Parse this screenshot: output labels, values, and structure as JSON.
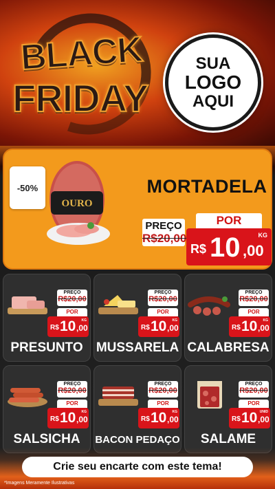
{
  "header": {
    "title_line1": "BLACK",
    "title_line2": "FRIDAY",
    "logo_line1": "SUA",
    "logo_line2": "LOGO",
    "logo_line3": "AQUI"
  },
  "hero": {
    "discount": "-50%",
    "name": "MORTADELA",
    "brand_label": "OURO",
    "price_label": "PREÇO",
    "old_price": "R$20,00",
    "por_label": "POR",
    "currency": "R$",
    "price_int": "10",
    "price_dec": ",00",
    "unit": "KG"
  },
  "products": [
    {
      "name": "PRESUNTO",
      "price_label": "PREÇO",
      "old_price": "R$20,00",
      "por_label": "POR",
      "currency": "R$",
      "price_int": "10",
      "price_dec": ",00",
      "unit": "KG"
    },
    {
      "name": "MUSSARELA",
      "price_label": "PREÇO",
      "old_price": "R$20,00",
      "por_label": "POR",
      "currency": "R$",
      "price_int": "10",
      "price_dec": ",00",
      "unit": "KG"
    },
    {
      "name": "CALABRESA",
      "price_label": "PREÇO",
      "old_price": "R$20,00",
      "por_label": "POR",
      "currency": "R$",
      "price_int": "10",
      "price_dec": ",00",
      "unit": "KG"
    },
    {
      "name": "SALSICHA",
      "price_label": "PREÇO",
      "old_price": "R$20,00",
      "por_label": "POR",
      "currency": "R$",
      "price_int": "10",
      "price_dec": ",00",
      "unit": "KG"
    },
    {
      "name": "BACON PEDAÇO",
      "price_label": "PREÇO",
      "old_price": "R$20,00",
      "por_label": "POR",
      "currency": "R$",
      "price_int": "10",
      "price_dec": ",00",
      "unit": "KG"
    },
    {
      "name": "SALAME",
      "price_label": "PREÇO",
      "old_price": "R$20,00",
      "por_label": "POR",
      "currency": "R$",
      "price_int": "10",
      "price_dec": ",00",
      "unit": "UNID"
    }
  ],
  "cta": "Crie seu encarte com este tema!",
  "disclaimer": "*Imagens Meramente Ilustrativas"
}
